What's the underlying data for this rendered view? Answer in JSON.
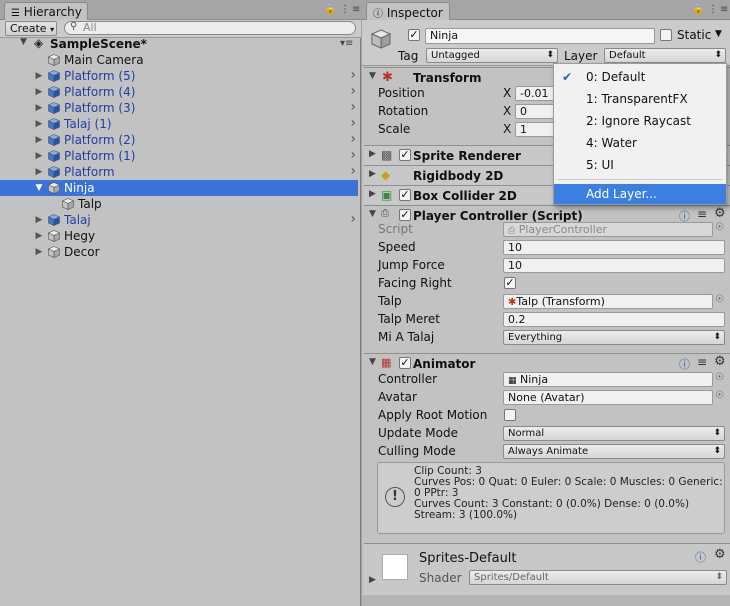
{
  "hierarchy": {
    "tab_label": "Hierarchy",
    "create_label": "Create",
    "search_placeholder": "All",
    "scene_name": "SampleScene*",
    "items": [
      {
        "label": "Main Camera",
        "prefab": false,
        "expandable": false,
        "depth": 1
      },
      {
        "label": "Platform (5)",
        "prefab": true,
        "expandable": true,
        "depth": 1
      },
      {
        "label": "Platform (4)",
        "prefab": true,
        "expandable": true,
        "depth": 1
      },
      {
        "label": "Platform (3)",
        "prefab": true,
        "expandable": true,
        "depth": 1
      },
      {
        "label": "Talaj (1)",
        "prefab": true,
        "expandable": true,
        "depth": 1
      },
      {
        "label": "Platform (2)",
        "prefab": true,
        "expandable": true,
        "depth": 1
      },
      {
        "label": "Platform (1)",
        "prefab": true,
        "expandable": true,
        "depth": 1
      },
      {
        "label": "Platform",
        "prefab": true,
        "expandable": true,
        "depth": 1
      },
      {
        "label": "Ninja",
        "prefab": false,
        "expandable": true,
        "depth": 1,
        "selected": true,
        "expanded": true
      },
      {
        "label": "Talp",
        "prefab": false,
        "expandable": false,
        "depth": 2
      },
      {
        "label": "Talaj",
        "prefab": true,
        "expandable": true,
        "depth": 1
      },
      {
        "label": "Hegy",
        "prefab": false,
        "expandable": true,
        "depth": 1
      },
      {
        "label": "Decor",
        "prefab": false,
        "expandable": true,
        "depth": 1
      }
    ]
  },
  "inspector": {
    "tab_label": "Inspector",
    "object_name": "Ninja",
    "static_label": "Static",
    "tag_label": "Tag",
    "tag_value": "Untagged",
    "layer_label": "Layer",
    "layer_value": "Default",
    "transform": {
      "title": "Transform",
      "position_label": "Position",
      "position_x": "-0.01",
      "rotation_label": "Rotation",
      "rotation_x": "0",
      "scale_label": "Scale",
      "scale_x": "1",
      "x_label": "X"
    },
    "sprite_renderer": "Sprite Renderer",
    "rigidbody": "Rigidbody 2D",
    "box_collider": "Box Collider 2D",
    "player_controller": {
      "title": "Player Controller (Script)",
      "script_label": "Script",
      "script_value": "PlayerController",
      "speed_label": "Speed",
      "speed_value": "10",
      "jump_label": "Jump Force",
      "jump_value": "10",
      "facing_label": "Facing Right",
      "talp_label": "Talp",
      "talp_value": "Talp (Transform)",
      "talp_meret_label": "Talp Meret",
      "talp_meret_value": "0.2",
      "mi_a_talaj_label": "Mi A Talaj",
      "mi_a_talaj_value": "Everything"
    },
    "animator": {
      "title": "Animator",
      "controller_label": "Controller",
      "controller_value": "Ninja",
      "avatar_label": "Avatar",
      "avatar_value": "None (Avatar)",
      "root_motion_label": "Apply Root Motion",
      "update_label": "Update Mode",
      "update_value": "Normal",
      "culling_label": "Culling Mode",
      "culling_value": "Always Animate",
      "info": [
        "Clip Count: 3",
        "Curves Pos: 0 Quat: 0 Euler: 0 Scale: 0 Muscles: 0 Generic:",
        "0 PPtr: 3",
        "Curves Count: 3 Constant: 0 (0.0%) Dense: 0 (0.0%)",
        "Stream: 3 (100.0%)"
      ]
    },
    "material": {
      "name": "Sprites-Default",
      "shader_label": "Shader",
      "shader_value": "Sprites/Default"
    }
  },
  "layer_menu": {
    "items": [
      "0: Default",
      "1: TransparentFX",
      "2: Ignore Raycast",
      "4: Water",
      "5: UI"
    ],
    "checked_index": 0,
    "add_label": "Add Layer..."
  },
  "colors": {
    "selection": "#3a72d8",
    "prefab_text": "#1f3fa8",
    "menu_highlight": "#3b7fe0"
  }
}
